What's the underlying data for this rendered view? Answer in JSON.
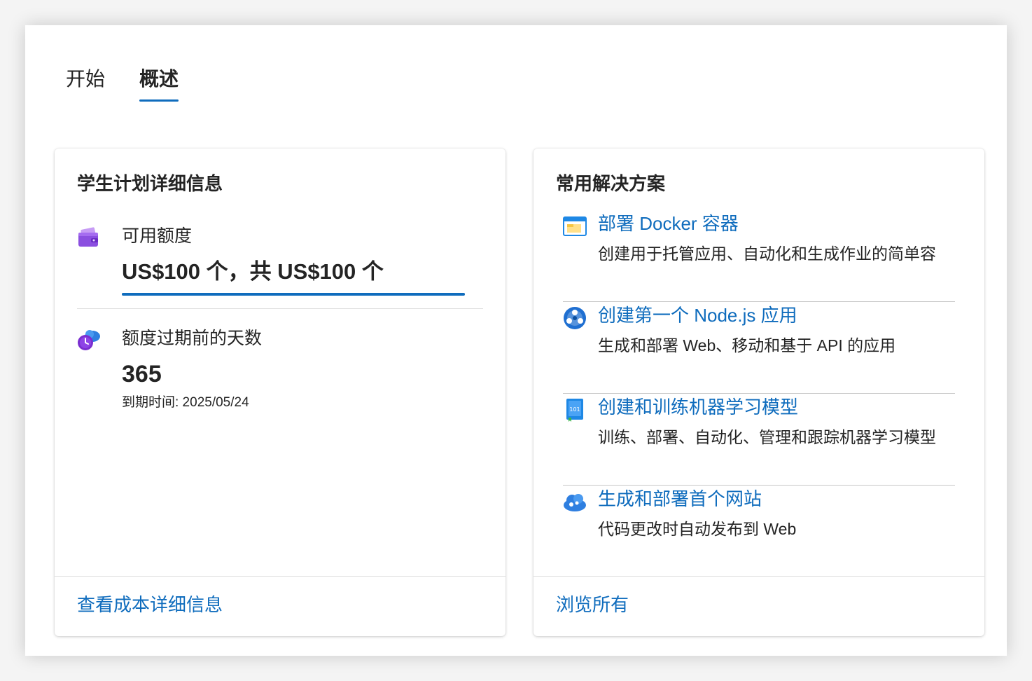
{
  "tabs": [
    {
      "label": "开始",
      "active": false
    },
    {
      "label": "概述",
      "active": true
    }
  ],
  "student_plan": {
    "title": "学生计划详细信息",
    "credit": {
      "icon": "wallet-icon",
      "label": "可用额度",
      "value": "US$100 个，共 US$100 个",
      "remaining_fraction": 1.0
    },
    "days": {
      "icon": "clock-cloud-icon",
      "label": "额度过期前的天数",
      "value": "365",
      "expiry": "到期时间: 2025/05/24"
    },
    "footer_link": "查看成本详细信息"
  },
  "solutions": {
    "title": "常用解决方案",
    "items": [
      {
        "icon": "docker-container-icon",
        "title": "部署 Docker 容器",
        "description": "创建用于托管应用、自动化和生成作业的简单容器"
      },
      {
        "icon": "nodejs-app-icon",
        "title": "创建第一个 Node.js 应用",
        "description": "生成和部署 Web、移动和基于 API 的应用"
      },
      {
        "icon": "machine-learning-icon",
        "title": "创建和训练机器学习模型",
        "description": "训练、部署、自动化、管理和跟踪机器学习模型"
      },
      {
        "icon": "cloud-website-icon",
        "title": "生成和部署首个网站",
        "description": "代码更改时自动发布到 Web"
      }
    ],
    "footer_link": "浏览所有"
  },
  "colors": {
    "accent": "#0f6cbd",
    "wallet": "#8b4fe0",
    "clock": "#7a2fd0"
  }
}
